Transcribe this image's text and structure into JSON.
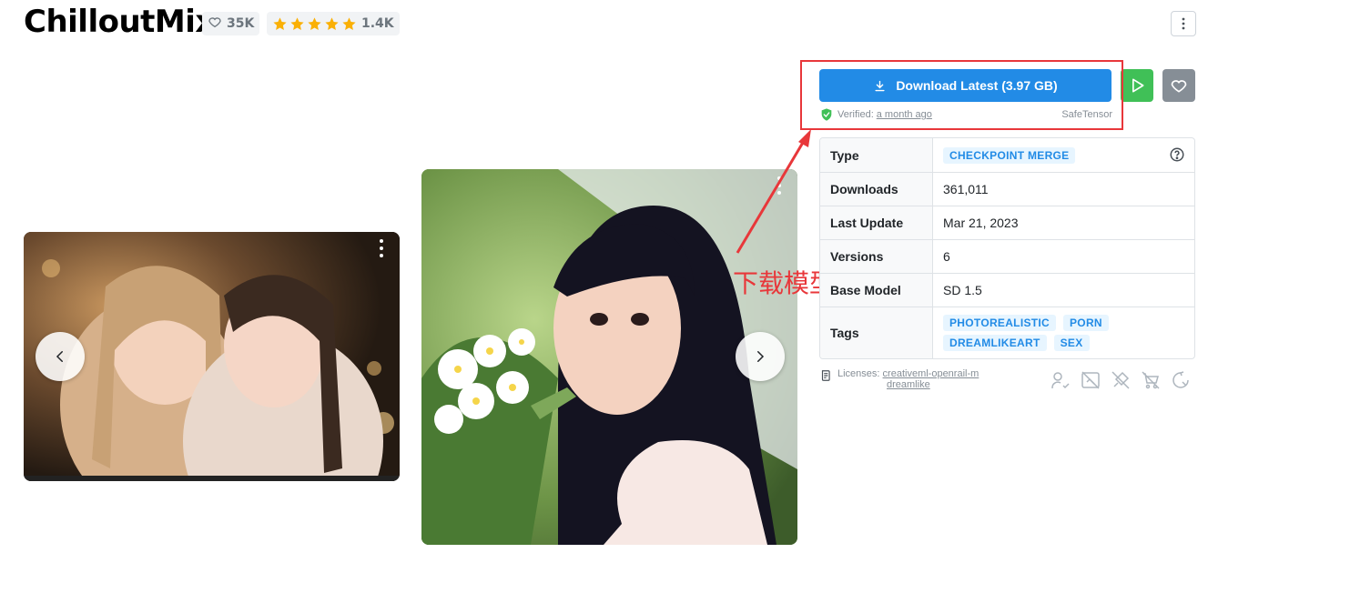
{
  "model": {
    "title": "ChilloutMix",
    "likes": "35K",
    "rating_count": "1.4K",
    "rating_stars": 5
  },
  "download": {
    "label": "Download Latest (3.97 GB)",
    "verified_label": "Verified:",
    "verified_time": "a month ago",
    "format": "SafeTensor"
  },
  "annotation": {
    "text": "下载模型",
    "color": "#e8373a"
  },
  "details": {
    "rows": [
      {
        "key": "Type",
        "value": "CHECKPOINT MERGE"
      },
      {
        "key": "Downloads",
        "value": "361,011"
      },
      {
        "key": "Last Update",
        "value": "Mar 21, 2023"
      },
      {
        "key": "Versions",
        "value": "6"
      },
      {
        "key": "Base Model",
        "value": "SD 1.5"
      },
      {
        "key": "Tags",
        "value": [
          "PHOTOREALISTIC",
          "PORN",
          "DREAMLIKEART",
          "SEX"
        ]
      }
    ]
  },
  "license": {
    "label": "Licenses:",
    "links": [
      "creativeml-openrail-m",
      "dreamlike"
    ]
  },
  "permission_icons": [
    "user-check-icon",
    "no-image-sell-icon",
    "no-rent-icon",
    "no-sell-icon",
    "no-merge-icon"
  ],
  "colors": {
    "primary": "#228be6",
    "run": "#40c057",
    "favorite": "#868e96",
    "star": "#fab005",
    "tag_bg": "#e7f5ff"
  },
  "icons": [
    "heart-icon",
    "star-icon",
    "vertical-dots-icon",
    "download-icon",
    "play-icon",
    "chevron-left-icon",
    "chevron-right-icon",
    "shield-check-icon",
    "help-circle-icon",
    "scroll-icon"
  ]
}
